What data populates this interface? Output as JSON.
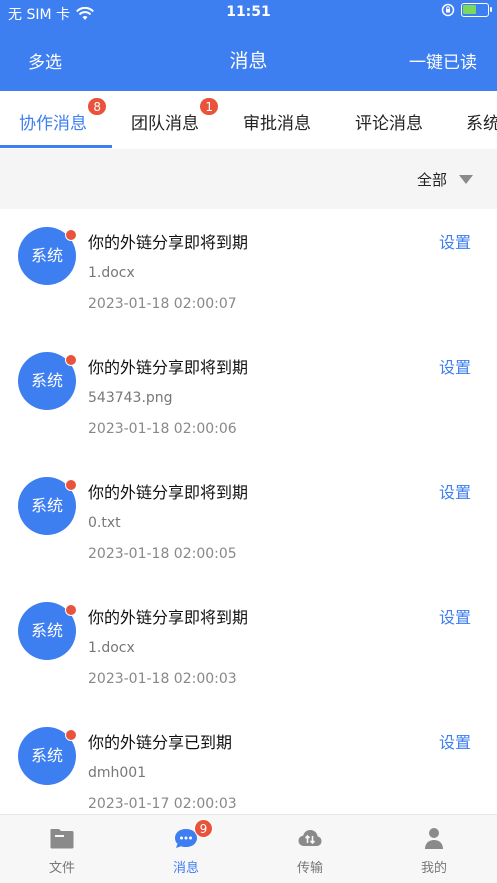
{
  "status_bar": {
    "carrier": "无 SIM 卡",
    "time": "11:51",
    "battery_level": 0.55,
    "battery_fill_color": "#7bd85b"
  },
  "header": {
    "left_action": "多选",
    "title": "消息",
    "right_action": "一键已读",
    "bg_color": "#3d7ef0"
  },
  "tabs": [
    {
      "label": "协作消息",
      "badge": "8",
      "active": true
    },
    {
      "label": "团队消息",
      "badge": "1",
      "active": false
    },
    {
      "label": "审批消息",
      "badge": "",
      "active": false
    },
    {
      "label": "评论消息",
      "badge": "",
      "active": false
    },
    {
      "label": "系统",
      "badge": "",
      "active": false
    }
  ],
  "filter": {
    "value": "全部",
    "icon": "caret-down-icon"
  },
  "messages": [
    {
      "avatar": "系统",
      "title": "你的外链分享即将到期",
      "file": "1.docx",
      "time": "2023-01-18 02:00:07",
      "action": "设置",
      "unread": true
    },
    {
      "avatar": "系统",
      "title": "你的外链分享即将到期",
      "file": "543743.png",
      "time": "2023-01-18 02:00:06",
      "action": "设置",
      "unread": true
    },
    {
      "avatar": "系统",
      "title": "你的外链分享即将到期",
      "file": "0.txt",
      "time": "2023-01-18 02:00:05",
      "action": "设置",
      "unread": true
    },
    {
      "avatar": "系统",
      "title": "你的外链分享即将到期",
      "file": "1.docx",
      "time": "2023-01-18 02:00:03",
      "action": "设置",
      "unread": true
    },
    {
      "avatar": "系统",
      "title": "你的外链分享已到期",
      "file": "dmh001",
      "time": "2023-01-17 02:00:03",
      "action": "设置",
      "unread": true
    }
  ],
  "tabbar": [
    {
      "label": "文件",
      "icon": "folder-icon",
      "badge": "",
      "active": false
    },
    {
      "label": "消息",
      "icon": "chat-bubble-icon",
      "badge": "9",
      "active": true
    },
    {
      "label": "传输",
      "icon": "cloud-transfer-icon",
      "badge": "",
      "active": false
    },
    {
      "label": "我的",
      "icon": "person-icon",
      "badge": "",
      "active": false
    }
  ]
}
